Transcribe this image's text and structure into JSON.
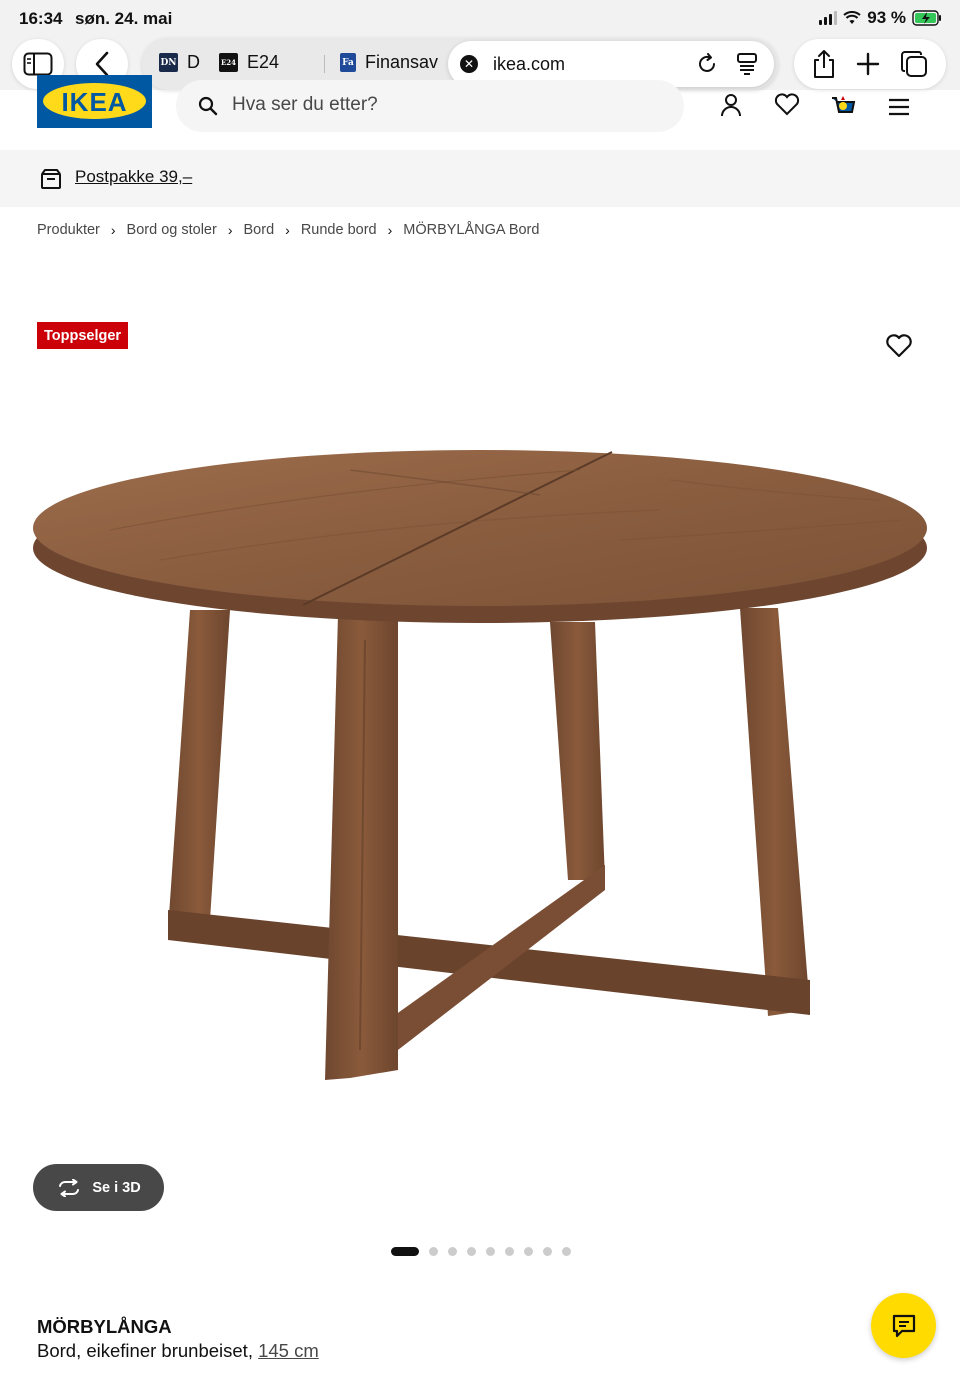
{
  "status_bar": {
    "time": "16:34",
    "date": "søn. 24. mai",
    "battery": "93 %"
  },
  "browser": {
    "tabs": [
      {
        "favicon": "DN",
        "title": "D",
        "favicon_color": "#1a2a4a"
      },
      {
        "favicon": "E24",
        "title": "E24",
        "favicon_color": "#111111"
      },
      {
        "favicon": "Fa",
        "title": "Finansav",
        "favicon_color": "#1f4a9a"
      }
    ],
    "active_tab": {
      "url": "ikea.com"
    }
  },
  "header": {
    "logo_text": "IKEA",
    "search_placeholder": "Hva ser du etter?"
  },
  "promo": {
    "text": "Postpakke 39,–"
  },
  "breadcrumb": [
    "Produkter",
    "Bord og stoler",
    "Bord",
    "Runde bord",
    "MÖRBYLÅNGA Bord"
  ],
  "product": {
    "badge": "Toppselger",
    "view_3d_label": "Se i 3D",
    "image_count": 9,
    "active_image": 1,
    "name": "MÖRBYLÅNGA",
    "description": "Bord, eikefiner brunbeiset,",
    "size": "145 cm"
  },
  "colors": {
    "ikea_blue": "#0058a3",
    "ikea_yellow": "#ffda1a",
    "badge_red": "#cc0008",
    "chat_yellow": "#ffdb00",
    "wood": "#8a5a3b"
  }
}
